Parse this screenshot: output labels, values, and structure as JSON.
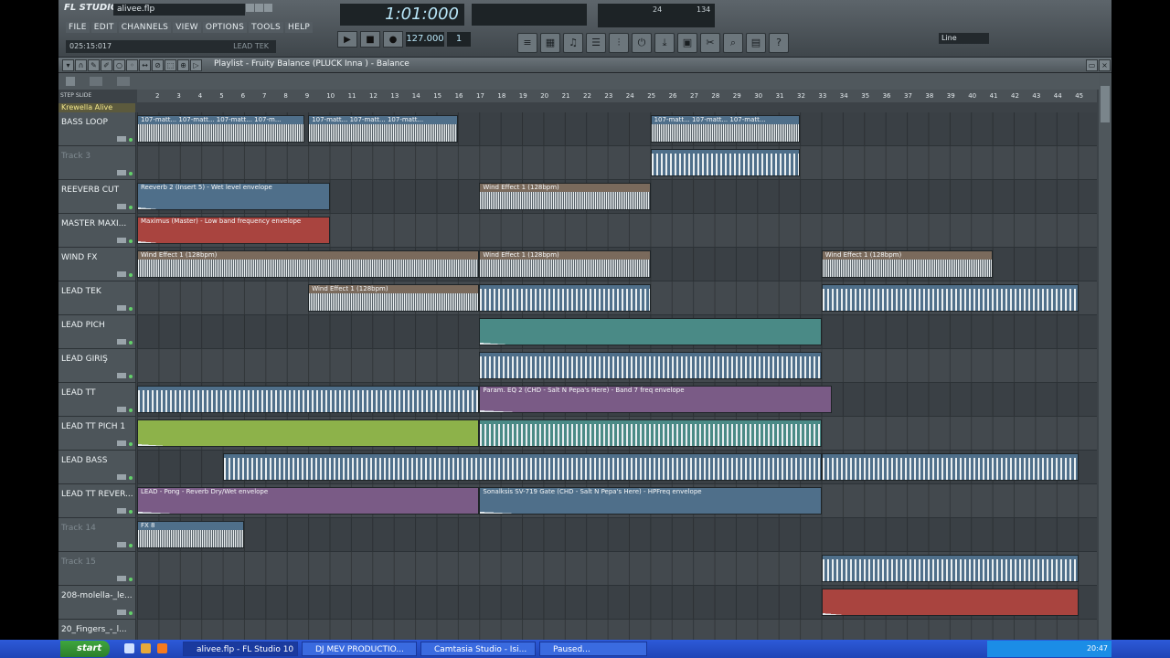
{
  "app": {
    "logo": "FL STUDIO",
    "filename": "alivee.flp",
    "menu": [
      "FILE",
      "EDIT",
      "CHANNELS",
      "VIEW",
      "OPTIONS",
      "TOOLS",
      "HELP"
    ],
    "time_display": "025:15:017",
    "hint_text": "LEAD TEK",
    "song_position": "1:01:000",
    "tempo": "127.000",
    "pattern": "1",
    "cpu": "24",
    "poly": "134",
    "snap": "Line"
  },
  "playlist": {
    "title": "Playlist - Fruity Balance (PLUCK Inna ) - Balance",
    "step_label": "STEP",
    "slide_label": "SLIDE",
    "ruler": [
      "2",
      "3",
      "4",
      "5",
      "6",
      "7",
      "8",
      "9",
      "10",
      "11",
      "12",
      "13",
      "14",
      "15",
      "16",
      "17",
      "18",
      "19",
      "20",
      "21",
      "22",
      "23",
      "24",
      "25",
      "26",
      "27",
      "28",
      "29",
      "30",
      "31",
      "32",
      "33",
      "34",
      "35",
      "36",
      "37",
      "38",
      "39",
      "40",
      "41",
      "42",
      "43",
      "44",
      "45"
    ],
    "header_track": "Krewella Alive",
    "tracks": [
      {
        "name": "BASS LOOP",
        "dim": false
      },
      {
        "name": "Track 3",
        "dim": true
      },
      {
        "name": "REEVERB CUT",
        "dim": false
      },
      {
        "name": "MASTER MAXI...",
        "dim": false
      },
      {
        "name": "WIND FX",
        "dim": false
      },
      {
        "name": "LEAD TEK",
        "dim": false
      },
      {
        "name": "LEAD PICH",
        "dim": false
      },
      {
        "name": "LEAD GİRİŞ",
        "dim": false
      },
      {
        "name": "LEAD  TT",
        "dim": false
      },
      {
        "name": "LEAD TT PICH 1",
        "dim": false
      },
      {
        "name": "LEAD BASS",
        "dim": false
      },
      {
        "name": "LEAD TT REVER...",
        "dim": false
      },
      {
        "name": "Track 14",
        "dim": true
      },
      {
        "name": "Track 15",
        "dim": true
      },
      {
        "name": "208-molella-_le...",
        "dim": false
      },
      {
        "name": "20_Fingers_-_l...",
        "dim": false
      }
    ],
    "clips": {
      "bass1": "107-matt... 107-matt... 107-matt... 107-m...",
      "bass2": "107-matt... 107-matt... 107-matt...",
      "bass3": "107-matt... 107-matt... 107-matt...",
      "reverb": "Reeverb 2 (Insert 5) - Wet level envelope",
      "wind_a": "Wind Effect 1 (128bpm)",
      "maximus": "Maximus (Master) - Low band frequency envelope",
      "wind_b": "Wind Effect 1 (128bpm)",
      "wind_c": "Wind Effect 1 (128bpm)",
      "wind_d": "Wind Effect 1 (128bpm)",
      "wind_e": "Wind Effect 1 (128bpm)",
      "parameq": "Param. EQ 2 (CHD - Salt N Pepa's Here) - Band 7 freq envelope",
      "pong": "LEAD - Pong - Reverb Dry/Wet envelope",
      "sonalksis": "Sonalksis SV-719 Gate (CHD - Salt N Pepa's Here) - HPFreq  envelope",
      "fx8": "FX 8"
    }
  },
  "taskbar": {
    "start": "start",
    "tasks": [
      "alivee.flp - FL Studio 10",
      "DJ MEV PRODUCTIO...",
      "Camtasia Studio - Isi...",
      "Paused..."
    ],
    "clock": "20:47"
  },
  "colors": {
    "blue_clip": "#4f6f8a",
    "brown_clip": "#7a6a5c",
    "red_clip": "#a9443f",
    "purple_clip": "#7a5b86",
    "teal_clip": "#4a8a86",
    "green_clip": "#8db24a"
  }
}
